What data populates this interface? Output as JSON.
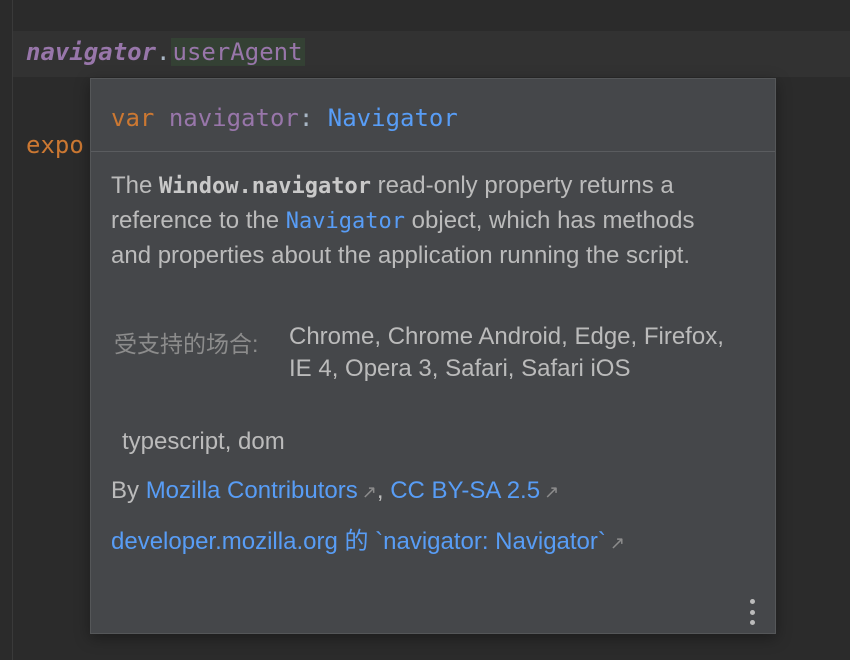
{
  "editor": {
    "line1": {
      "object": "navigator",
      "dot": ".",
      "property": "userAgent"
    },
    "line2": {
      "keyword_partial": "expo"
    }
  },
  "popup": {
    "signature": {
      "keyword": "var",
      "name": "navigator",
      "colon": ":",
      "type": "Navigator"
    },
    "description": {
      "part1": "The ",
      "code1": "Window.navigator",
      "part2": " read-only property returns a reference to the ",
      "code2": "Navigator",
      "part3": " object, which has methods and properties about the application running the script."
    },
    "support": {
      "label": "受支持的场合:",
      "value": "Chrome, Chrome Android, Edge, Firefox, IE 4, Opera 3, Safari, Safari iOS"
    },
    "libraries": "typescript, dom",
    "attribution": {
      "prefix": "By ",
      "author": "Mozilla Contributors",
      "separator": ",",
      "license": "CC BY-SA 2.5"
    },
    "source_link": "developer.mozilla.org 的 `navigator: Navigator`",
    "icons": {
      "external": "external-link-icon",
      "more": "more-vertical-icon"
    }
  },
  "colors": {
    "background": "#2b2b2b",
    "popup_bg": "#45474a",
    "keyword": "#cc7832",
    "identifier": "#9876aa",
    "type_link": "#589df6",
    "text": "#bbbbbb"
  }
}
